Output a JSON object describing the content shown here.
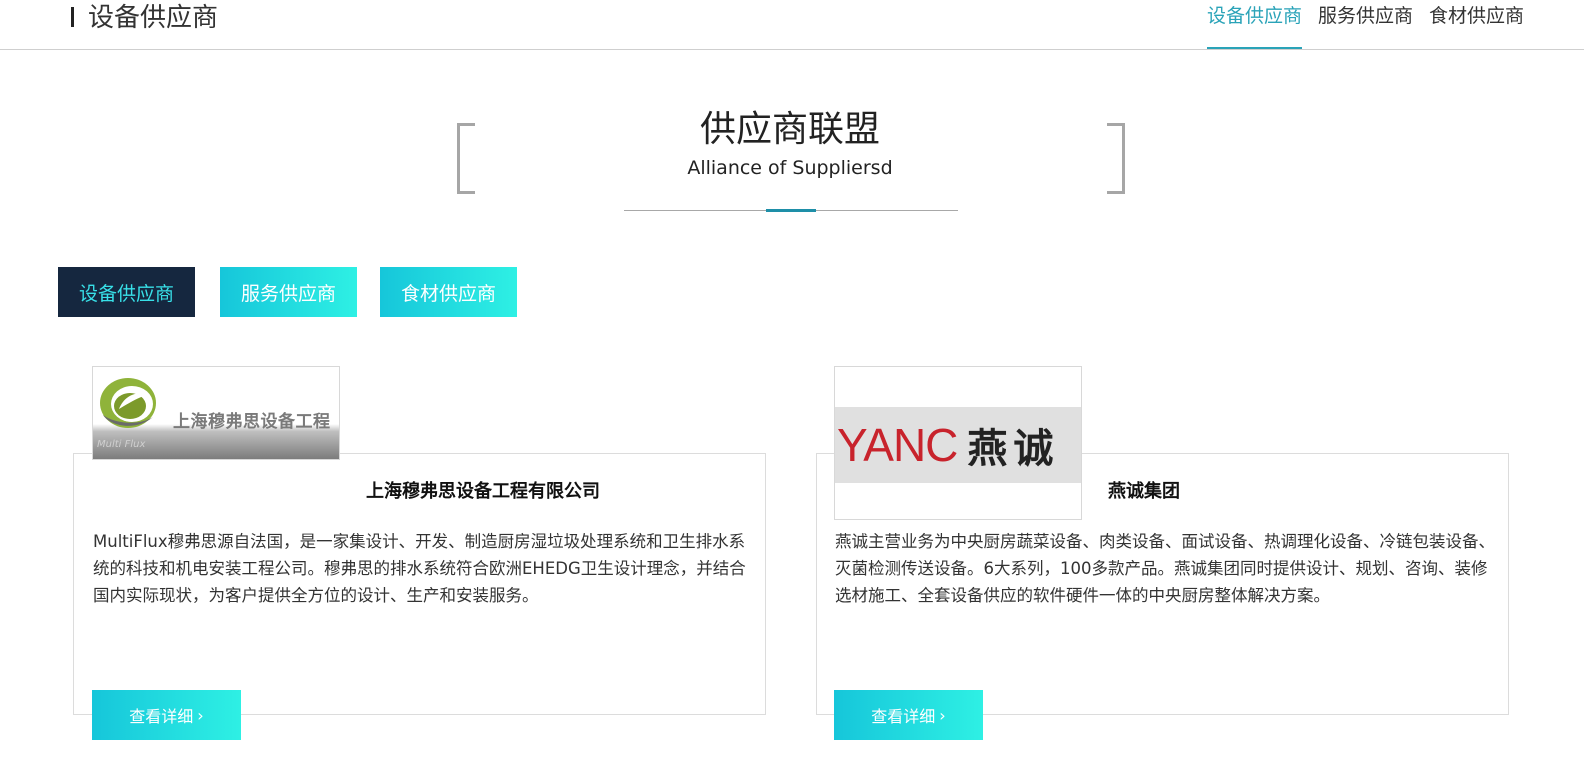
{
  "header": {
    "title": "设备供应商",
    "nav": [
      {
        "label": "设备供应商",
        "active": true
      },
      {
        "label": "服务供应商",
        "active": false
      },
      {
        "label": "食材供应商",
        "active": false
      }
    ]
  },
  "section": {
    "title": "供应商联盟",
    "subtitle": "Alliance of Suppliersd"
  },
  "tabs": [
    {
      "label": "设备供应商",
      "active": true
    },
    {
      "label": "服务供应商",
      "active": false
    },
    {
      "label": "食材供应商",
      "active": false
    }
  ],
  "suppliers": [
    {
      "name": "上海穆弗思设备工程有限公司",
      "logo_text": "上海穆弗思设备工程",
      "logo_small": "Multi Flux",
      "description": "MultiFlux穆弗思源自法国，是一家集设计、开发、制造厨房湿垃圾处理系统和卫生排水系统的科技和机电安装工程公司。穆弗思的排水系统符合欧洲EHEDG卫生设计理念，并结合国内实际现状，为客户提供全方位的设计、生产和安装服务。",
      "button": "查看详细"
    },
    {
      "name": "燕诚集团",
      "logo_en": "YANC",
      "logo_cn": "燕诚",
      "description": "燕诚主营业务为中央厨房蔬菜设备、肉类设备、面试设备、热调理化设备、冷链包装设备、灭菌检测传送设备。6大系列，100多款产品。燕诚集团同时提供设计、规划、咨询、装修选材施工、全套设备供应的软件硬件一体的中央厨房整体解决方案。",
      "button": "查看详细"
    }
  ],
  "colors": {
    "accent": "#2aa3b8",
    "tab_active_bg": "#15273f",
    "tab_active_text": "#38e0e8",
    "gradient_start": "#16c6da",
    "gradient_end": "#2ef0e4",
    "logo_red": "#c8232c"
  },
  "icons": {
    "chevron": "chevron-right-icon"
  }
}
